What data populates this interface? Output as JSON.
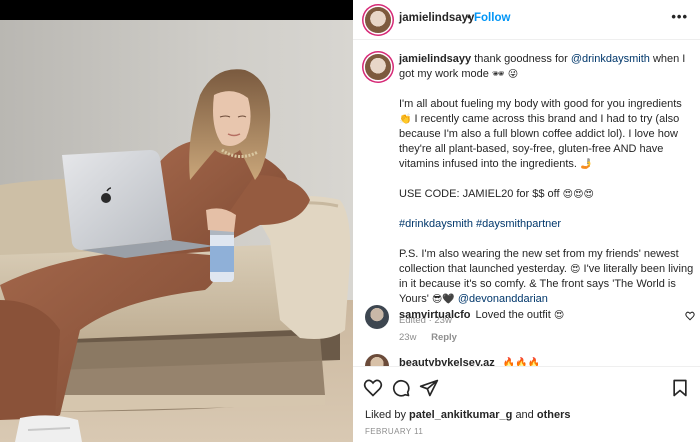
{
  "post": {
    "username": "jamielindsayy",
    "follow_label": "Follow",
    "more_label": "•••",
    "caption": {
      "username": "jamielindsayy",
      "line1_pre": "thank goodness for",
      "mention_brand": "@drinkdaysmith",
      "line1_post": "when I got my work mode",
      "line1_emoji": "🕶 😜",
      "para2": "I'm all about fueling my body with good for you ingredients",
      "para2b": "I recently came across this brand and I had to try (also because I'm also a full blown coffee addict lol). I love how they're all plant-based, soy-free, gluten-free AND have vitamins infused into the ingredients.",
      "para2_emoji_a": "👏",
      "para2_emoji_b": "🤳",
      "code_line": "USE CODE: JAMIEL20 for $$ off",
      "code_emoji": "😍😍😍",
      "hashtags": "#drinkdaysmith #daysmithpartner",
      "ps_text": "P.S. I'm also wearing the new set from my friends' newest collection that launched yesterday.",
      "ps_text2": "I've literally been living in it because it's so comfy. & The front says 'The World is Yours'",
      "ps_emoji_a": "😍",
      "ps_emoji_b": "😎🖤",
      "mention_designer": "@devonanddarian",
      "edited": "Edited · 23w"
    },
    "comments": [
      {
        "username": "samvirtualcfo",
        "text": "Loved the outfit",
        "emoji": "😍",
        "time": "23w",
        "reply": "Reply"
      },
      {
        "username": "beautybykelsey.az",
        "text": "",
        "emoji": "🔥🔥🔥",
        "time": "",
        "reply": ""
      }
    ],
    "liked_by_prefix": "Liked by",
    "liked_by_user": "patel_ankitkumar_g",
    "liked_by_and": "and",
    "liked_by_others": "others",
    "date": "FEBRUARY 11"
  },
  "icons": [
    "heart-icon",
    "comment-icon",
    "share-icon",
    "bookmark-icon",
    "laptop-apple-logo"
  ],
  "colors": {
    "link": "#00376b",
    "follow": "#0095f6",
    "muted": "#8e8e8e",
    "story_ring": "#d62976"
  }
}
